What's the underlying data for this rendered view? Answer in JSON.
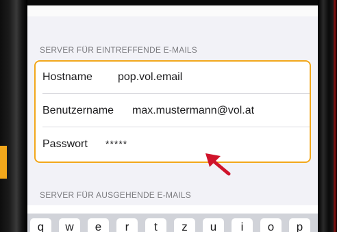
{
  "sections": {
    "incoming_header": "SERVER FÜR EINTREFFENDE E-MAILS",
    "outgoing_header": "SERVER FÜR AUSGEHENDE E-MAILS"
  },
  "incoming": {
    "hostname_label": "Hostname",
    "hostname_value": "pop.vol.email",
    "username_label": "Benutzername",
    "username_value": "max.mustermann@vol.at",
    "password_label": "Passwort",
    "password_value": "*****"
  },
  "keyboard": {
    "keys": [
      "q",
      "w",
      "e",
      "r",
      "t",
      "z",
      "u",
      "i",
      "o",
      "p"
    ]
  },
  "colors": {
    "highlight": "#f2a71b",
    "arrow": "#d0142b",
    "section_header": "#7c7c80"
  },
  "icons": {
    "annotation": "arrow-pointer-icon"
  }
}
